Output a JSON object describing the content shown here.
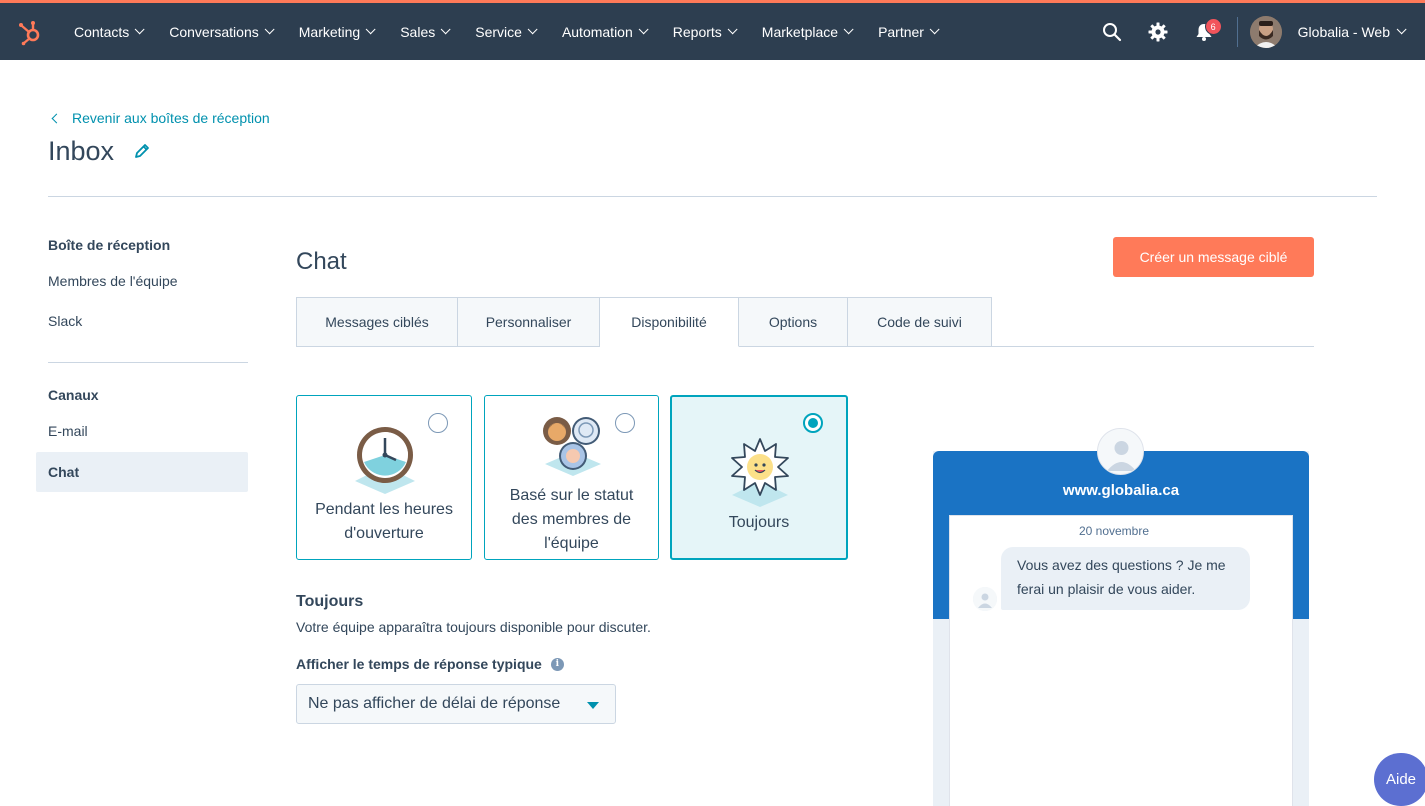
{
  "nav": {
    "items": [
      {
        "label": "Contacts"
      },
      {
        "label": "Conversations"
      },
      {
        "label": "Marketing"
      },
      {
        "label": "Sales"
      },
      {
        "label": "Service"
      },
      {
        "label": "Automation"
      },
      {
        "label": "Reports"
      },
      {
        "label": "Marketplace"
      },
      {
        "label": "Partner"
      }
    ],
    "notification_count": "6",
    "account_name": "Globalia - Web",
    "accent_color": "#ff7a59",
    "bar_color": "#2d3e50"
  },
  "header": {
    "back_label": "Revenir aux boîtes de réception",
    "title": "Inbox"
  },
  "sidebar": {
    "group1_title": "Boîte de réception",
    "group1_items": [
      "Membres de l'équipe",
      "Slack"
    ],
    "group2_title": "Canaux",
    "group2_items": [
      "E-mail",
      "Chat"
    ],
    "active": "Chat"
  },
  "main": {
    "title": "Chat",
    "cta_label": "Créer un message ciblé",
    "tabs": [
      "Messages ciblés",
      "Personnaliser",
      "Disponibilité",
      "Options",
      "Code de suivi"
    ],
    "active_tab": "Disponibilité",
    "options": [
      {
        "label_line1": "Pendant les heures",
        "label_line2": "d'ouverture",
        "selected": false
      },
      {
        "label_line1": "Basé sur le statut",
        "label_line2": "des membres de",
        "label_line3": "l'équipe",
        "selected": false
      },
      {
        "label_line1": "Toujours",
        "selected": true
      }
    ],
    "mode_title": "Toujours",
    "mode_desc": "Votre équipe apparaîtra toujours disponible pour discuter.",
    "field_label": "Afficher le temps de réponse typique",
    "select_value": "Ne pas afficher de délai de réponse"
  },
  "preview": {
    "site": "www.globalia.ca",
    "date": "20 novembre",
    "message_line1": "Vous avez des questions ? Je me",
    "message_line2": "ferai un plaisir de vous aider.",
    "head_color": "#1a73c4"
  },
  "help_label": "Aide"
}
